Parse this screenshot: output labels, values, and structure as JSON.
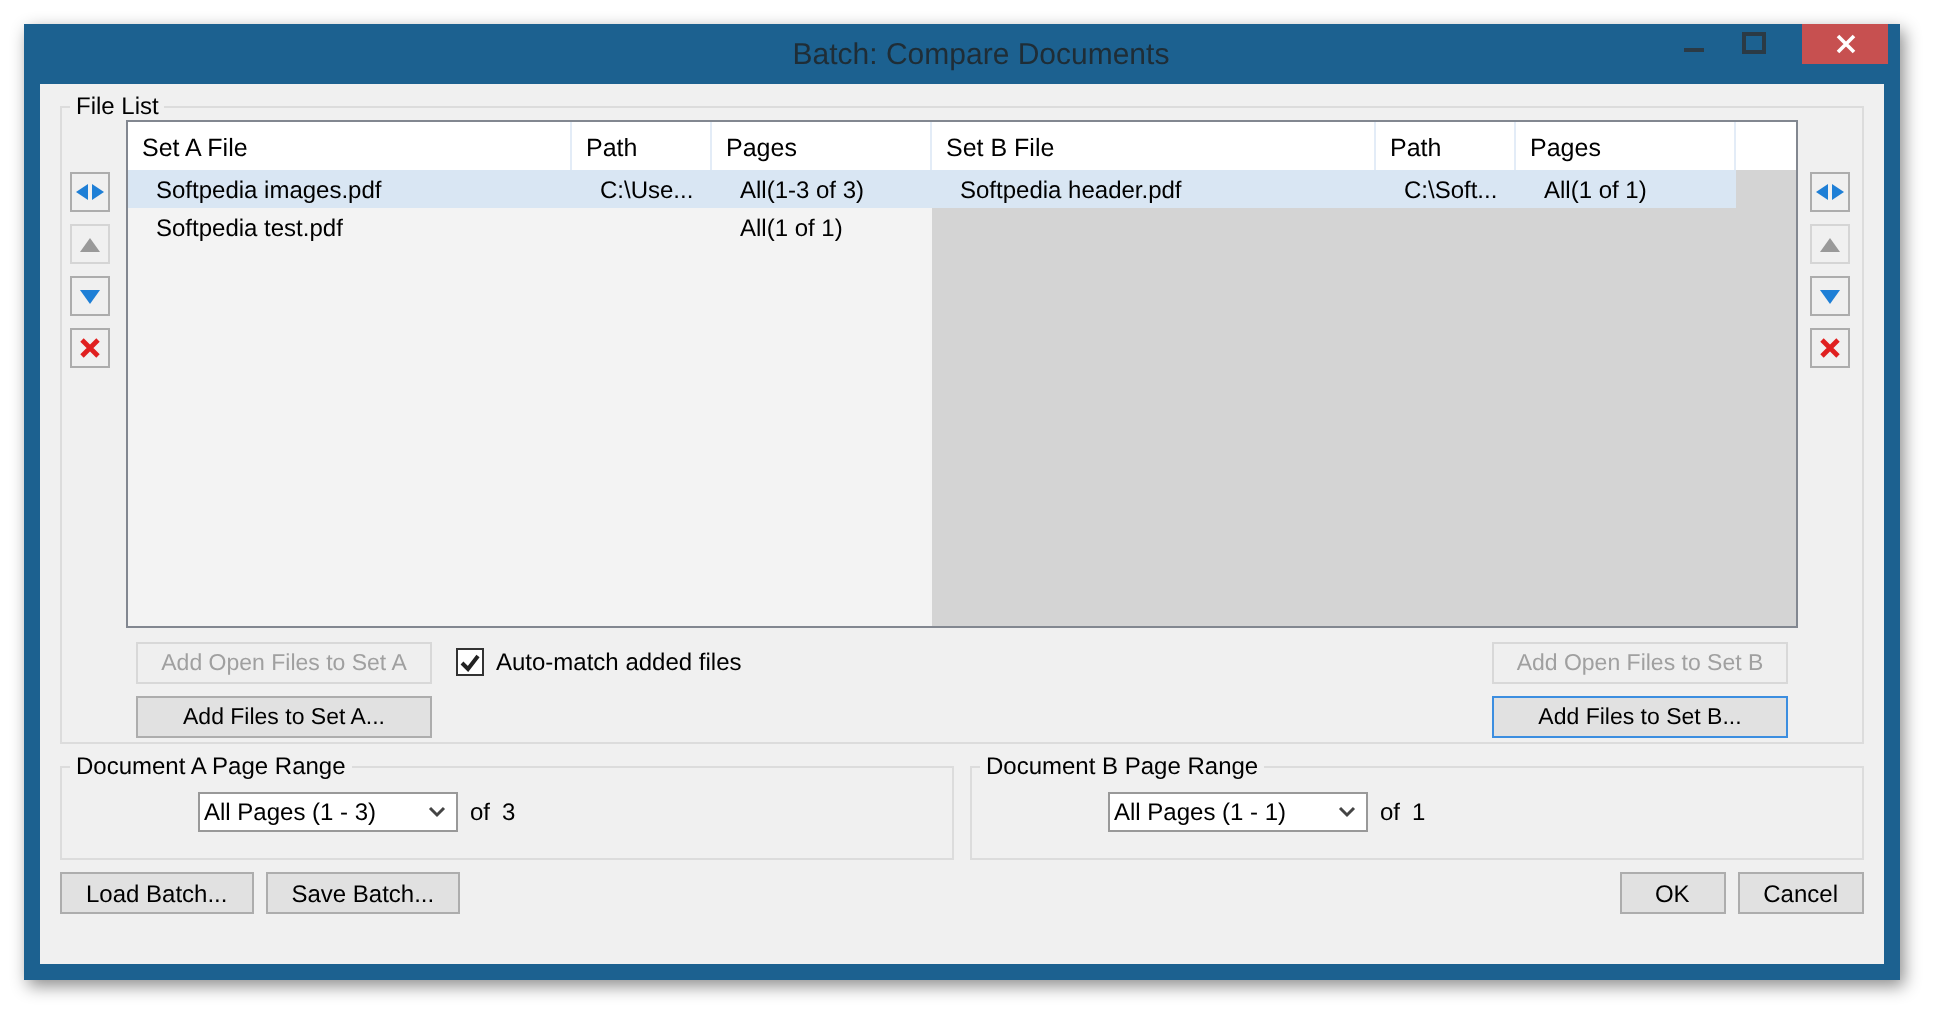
{
  "window": {
    "title": "Batch: Compare Documents"
  },
  "file_list": {
    "title": "File List",
    "left_tools": [
      {
        "kind": "swap",
        "disabled": false
      },
      {
        "kind": "up",
        "disabled": true
      },
      {
        "kind": "down",
        "disabled": false
      },
      {
        "kind": "delete",
        "disabled": false
      }
    ],
    "right_tools": [
      {
        "kind": "swap",
        "disabled": false
      },
      {
        "kind": "up",
        "disabled": true
      },
      {
        "kind": "down",
        "disabled": false
      },
      {
        "kind": "delete",
        "disabled": false
      }
    ],
    "set_a": {
      "columns": [
        "Set A File",
        "Path",
        "Pages"
      ],
      "rows": [
        {
          "cells": [
            "Softpedia images.pdf",
            "C:\\Use...",
            "All(1-3 of 3)"
          ],
          "selected": true
        },
        {
          "cells": [
            "Softpedia test.pdf",
            "",
            "All(1 of 1)"
          ],
          "selected": false
        }
      ]
    },
    "set_b": {
      "columns": [
        "Set B File",
        "Path",
        "Pages"
      ],
      "rows": [
        {
          "cells": [
            "Softpedia header.pdf",
            "C:\\Soft...",
            "All(1 of 1)"
          ],
          "selected": true
        }
      ]
    },
    "add_open_a": {
      "label": "Add Open Files to Set A",
      "disabled": true
    },
    "add_files_a": {
      "label": "Add Files to Set A...",
      "disabled": false
    },
    "auto_match": {
      "label": "Auto-match added files",
      "checked": true
    },
    "add_open_b": {
      "label": "Add Open Files to Set B",
      "disabled": true
    },
    "add_files_b": {
      "label": "Add Files to Set B...",
      "disabled": false
    }
  },
  "range_a": {
    "title": "Document A Page Range",
    "value": "All Pages (1 - 3)",
    "of": "of",
    "count": "3"
  },
  "range_b": {
    "title": "Document B Page Range",
    "value": "All Pages (1 - 1)",
    "of": "of",
    "count": "1"
  },
  "bottom_left": [
    "Load Batch...",
    "Save Batch..."
  ],
  "bottom_right": [
    "OK",
    "Cancel"
  ]
}
